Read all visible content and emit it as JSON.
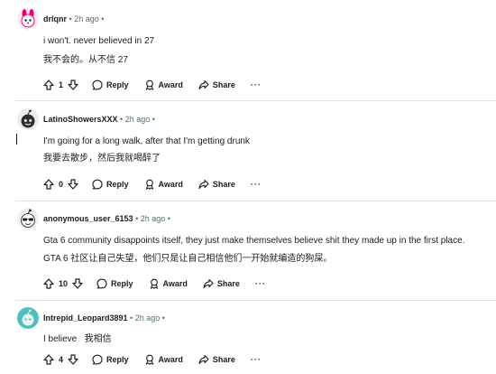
{
  "comments": [
    {
      "username": "drlqnr",
      "time": "2h ago",
      "lines": [
        "i won't. never believed in 27",
        "我不会的。从不信 27"
      ],
      "votes": "1",
      "actions": {
        "reply": "Reply",
        "award": "Award",
        "share": "Share"
      },
      "avatar": {
        "icon": "pink-bunny-avatar-icon",
        "bg": "#ffffff",
        "accent": "#e6007a"
      }
    },
    {
      "username": "LatinoShowersXXX",
      "time": "2h ago",
      "lines": [
        "I'm going for a long walk, after that I'm getting drunk",
        "我要去散步，然后我就喝醉了"
      ],
      "votes": "0",
      "actions": {
        "reply": "Reply",
        "award": "Award",
        "share": "Share"
      },
      "avatar": {
        "icon": "black-snoo-avatar-icon",
        "bg": "#ffffff",
        "accent": "#2d2d2d"
      }
    },
    {
      "username": "anonymous_user_6153",
      "time": "2h ago",
      "lines": [
        "Gta 6 community disappoints itself, they just make themselves believe shit they made up in the first place.",
        "GTA 6 社区让自己失望，他们只是让自己相信他们一开始就编造的狗屎。"
      ],
      "votes": "10",
      "actions": {
        "reply": "Reply",
        "award": "Award",
        "share": "Share"
      },
      "avatar": {
        "icon": "sunglasses-snoo-avatar-icon",
        "bg": "#ffffff",
        "accent": "#1c1c1c"
      }
    },
    {
      "username": "Intrepid_Leopard3891",
      "time": "2h ago",
      "lines": [
        "I believe   我相信"
      ],
      "votes": "4",
      "actions": {
        "reply": "Reply",
        "award": "Award",
        "share": "Share"
      },
      "avatar": {
        "icon": "teal-snoo-avatar-icon",
        "bg": "#4fbdba",
        "accent": "#ffffff"
      }
    }
  ],
  "more_label": "···",
  "separator": "•"
}
